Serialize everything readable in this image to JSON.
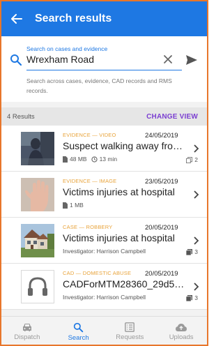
{
  "header": {
    "title": "Search results"
  },
  "search": {
    "caption": "Search on cases and evidence",
    "value": "Wrexham Road",
    "helper": "Search across cases, evidence, CAD records and RMS records."
  },
  "results_bar": {
    "count": "4 Results",
    "change_view": "CHANGE VIEW"
  },
  "results": [
    {
      "category": "EVIDENCE — VIDEO",
      "date": "24/05/2019",
      "title": "Suspect walking away from vi...",
      "size": "48 MB",
      "duration": "13 min",
      "count": "2"
    },
    {
      "category": "EVIDENCE — IMAGE",
      "date": "23/05/2019",
      "title": "Victims injuries at hospital",
      "size": "1 MB"
    },
    {
      "category": "CASE — ROBBERY",
      "date": "20/05/2019",
      "title": "Victims injuries at hospital",
      "investigator": "Investigator: Harrison Campbell",
      "count": "3"
    },
    {
      "category": "CAD — DOMESTIC ABUSE",
      "date": "20/05/2019",
      "title": "CADForMTM28360_29d59c9...",
      "investigator": "Investigator: Harrison Campbell",
      "count": "3"
    }
  ],
  "nav": [
    {
      "label": "Dispatch",
      "icon": "car-icon"
    },
    {
      "label": "Search",
      "icon": "search-icon",
      "active": true
    },
    {
      "label": "Requests",
      "icon": "list-icon"
    },
    {
      "label": "Uploads",
      "icon": "cloud-upload-icon"
    }
  ],
  "colors": {
    "primary": "#1e78e3",
    "accent": "#7b3fd1",
    "category": "#e8a33a",
    "frame": "#e8762b"
  }
}
